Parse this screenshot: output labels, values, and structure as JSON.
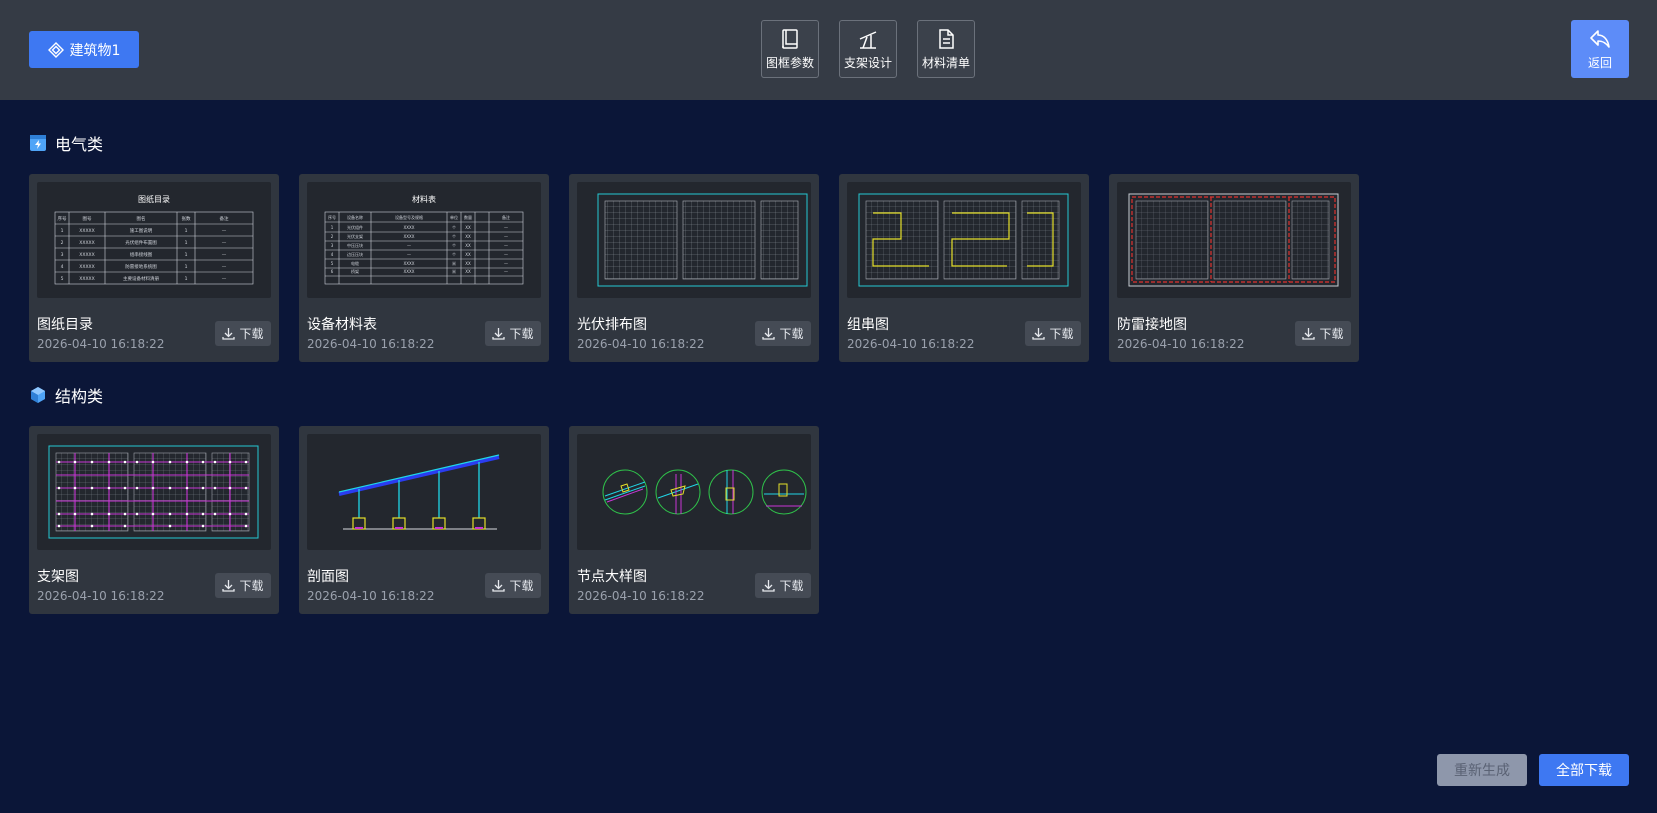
{
  "header": {
    "building_label": "建筑物1",
    "tools": [
      {
        "label": "图框参数",
        "icon": "book-icon"
      },
      {
        "label": "支架设计",
        "icon": "bracket-icon"
      },
      {
        "label": "材料清单",
        "icon": "document-icon"
      }
    ],
    "back_label": "返回"
  },
  "sections": [
    {
      "title": "电气类",
      "icon": "electrical-icon",
      "cards": [
        {
          "name": "图纸目录",
          "date": "2026-04-10 16:18:22",
          "download": "下载",
          "thumb_title": "图纸目录"
        },
        {
          "name": "设备材料表",
          "date": "2026-04-10 16:18:22",
          "download": "下载",
          "thumb_title": "材料表"
        },
        {
          "name": "光伏排布图",
          "date": "2026-04-10 16:18:22",
          "download": "下载"
        },
        {
          "name": "组串图",
          "date": "2026-04-10 16:18:22",
          "download": "下载"
        },
        {
          "name": "防雷接地图",
          "date": "2026-04-10 16:18:22",
          "download": "下载"
        }
      ]
    },
    {
      "title": "结构类",
      "icon": "cube-icon",
      "cards": [
        {
          "name": "支架图",
          "date": "2026-04-10 16:18:22",
          "download": "下载"
        },
        {
          "name": "剖面图",
          "date": "2026-04-10 16:18:22",
          "download": "下载"
        },
        {
          "name": "节点大样图",
          "date": "2026-04-10 16:18:22",
          "download": "下载"
        }
      ]
    }
  ],
  "footer": {
    "regenerate_label": "重新生成",
    "download_all_label": "全部下载"
  },
  "colors": {
    "background": "#0b1638",
    "primary": "#3e78f2",
    "card": "#30363f"
  }
}
